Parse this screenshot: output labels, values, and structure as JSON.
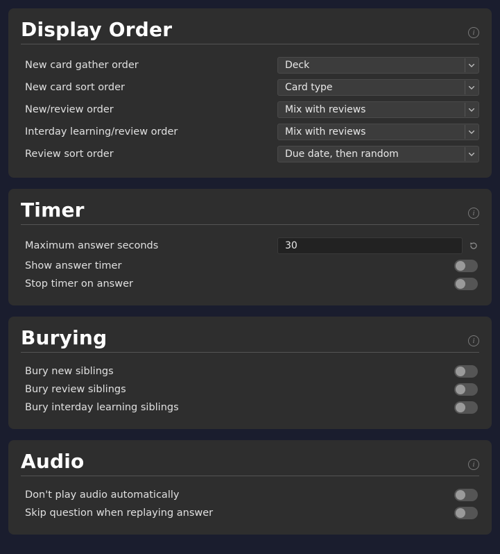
{
  "display_order": {
    "title": "Display Order",
    "rows": {
      "gather": {
        "label": "New card gather order",
        "value": "Deck"
      },
      "sort": {
        "label": "New card sort order",
        "value": "Card type"
      },
      "newrev": {
        "label": "New/review order",
        "value": "Mix with reviews"
      },
      "interday": {
        "label": "Interday learning/review order",
        "value": "Mix with reviews"
      },
      "revsort": {
        "label": "Review sort order",
        "value": "Due date, then random"
      }
    }
  },
  "timer": {
    "title": "Timer",
    "rows": {
      "maxsec": {
        "label": "Maximum answer seconds",
        "value": "30"
      },
      "show": {
        "label": "Show answer timer",
        "on": false
      },
      "stop": {
        "label": "Stop timer on answer",
        "on": false
      }
    }
  },
  "burying": {
    "title": "Burying",
    "rows": {
      "new": {
        "label": "Bury new siblings",
        "on": false
      },
      "rev": {
        "label": "Bury review siblings",
        "on": false
      },
      "inter": {
        "label": "Bury interday learning siblings",
        "on": false
      }
    }
  },
  "audio": {
    "title": "Audio",
    "rows": {
      "noauto": {
        "label": "Don't play audio automatically",
        "on": false
      },
      "skipq": {
        "label": "Skip question when replaying answer",
        "on": false
      }
    }
  }
}
